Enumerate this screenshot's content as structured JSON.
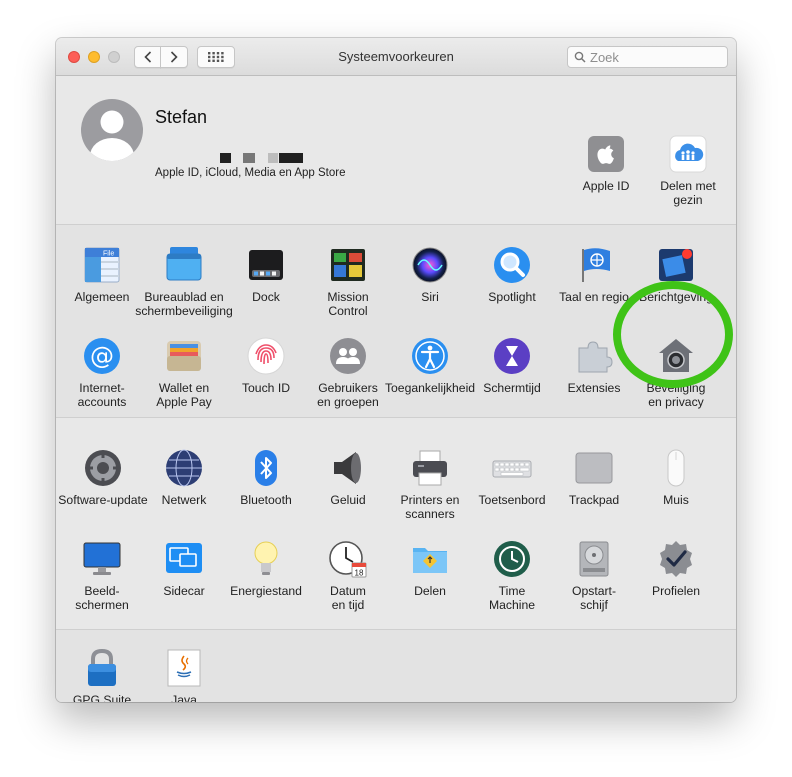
{
  "window": {
    "title": "Systeemvoorkeuren",
    "search_placeholder": "Zoek"
  },
  "account": {
    "name": "Stefan",
    "subtitle": "Apple ID, iCloud, Media en App Store"
  },
  "top_right": [
    {
      "label": "Apple ID",
      "icon": "apple-id-icon"
    },
    {
      "label": "Delen met\ngezin",
      "icon": "family-sharing-icon"
    }
  ],
  "section1": [
    {
      "label": "Algemeen",
      "icon": "general-icon"
    },
    {
      "label": "Bureaublad en\nschermbeveiliging",
      "icon": "desktop-screensaver-icon"
    },
    {
      "label": "Dock",
      "icon": "dock-icon"
    },
    {
      "label": "Mission\nControl",
      "icon": "mission-control-icon"
    },
    {
      "label": "Siri",
      "icon": "siri-icon"
    },
    {
      "label": "Spotlight",
      "icon": "spotlight-icon"
    },
    {
      "label": "Taal en regio",
      "icon": "language-region-icon"
    },
    {
      "label": "Berichtgeving",
      "icon": "notifications-icon"
    },
    {
      "label": "Internet-\naccounts",
      "icon": "internet-accounts-icon"
    },
    {
      "label": "Wallet en\nApple Pay",
      "icon": "wallet-icon"
    },
    {
      "label": "Touch ID",
      "icon": "touch-id-icon"
    },
    {
      "label": "Gebruikers\nen groepen",
      "icon": "users-groups-icon"
    },
    {
      "label": "Toegankelijkheid",
      "icon": "accessibility-icon"
    },
    {
      "label": "Schermtijd",
      "icon": "screen-time-icon"
    },
    {
      "label": "Extensies",
      "icon": "extensions-icon"
    },
    {
      "label": "Beveiliging\nen privacy",
      "icon": "security-privacy-icon"
    }
  ],
  "section2": [
    {
      "label": "Software-update",
      "icon": "software-update-icon"
    },
    {
      "label": "Netwerk",
      "icon": "network-icon"
    },
    {
      "label": "Bluetooth",
      "icon": "bluetooth-icon"
    },
    {
      "label": "Geluid",
      "icon": "sound-icon"
    },
    {
      "label": "Printers en\nscanners",
      "icon": "printer-icon"
    },
    {
      "label": "Toetsenbord",
      "icon": "keyboard-icon"
    },
    {
      "label": "Trackpad",
      "icon": "trackpad-icon"
    },
    {
      "label": "Muis",
      "icon": "mouse-icon"
    },
    {
      "label": "Beeld-\nschermen",
      "icon": "displays-icon"
    },
    {
      "label": "Sidecar",
      "icon": "sidecar-icon"
    },
    {
      "label": "Energiestand",
      "icon": "energy-saver-icon"
    },
    {
      "label": "Datum\nen tijd",
      "icon": "date-time-icon"
    },
    {
      "label": "Delen",
      "icon": "sharing-icon"
    },
    {
      "label": "Time\nMachine",
      "icon": "time-machine-icon"
    },
    {
      "label": "Opstart-\nschijf",
      "icon": "startup-disk-icon"
    },
    {
      "label": "Profielen",
      "icon": "profiles-icon"
    }
  ],
  "section3": [
    {
      "label": "GPG Suite",
      "icon": "gpg-suite-icon"
    },
    {
      "label": "Java",
      "icon": "java-icon"
    }
  ],
  "calendar_day": "18",
  "colors": {
    "highlight": "#3fc317",
    "window_bg": "#e8e8e8"
  }
}
